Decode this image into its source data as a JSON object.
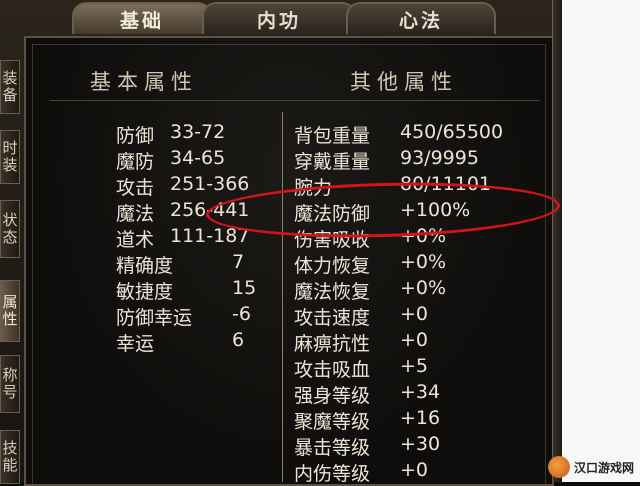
{
  "tabs": [
    {
      "label": "基础",
      "active": true
    },
    {
      "label": "内功",
      "active": false
    },
    {
      "label": "心法",
      "active": false
    }
  ],
  "side_tabs": [
    {
      "label": "装备",
      "active": false
    },
    {
      "label": "时装",
      "active": false
    },
    {
      "label": "状态",
      "active": false
    },
    {
      "label": "属性",
      "active": true
    },
    {
      "label": "称号",
      "active": false
    },
    {
      "label": "技能",
      "active": false
    }
  ],
  "left_section_title": "基本属性",
  "right_section_title": "其他属性",
  "basic_stats": [
    {
      "name": "防御",
      "value": "33-72"
    },
    {
      "name": "魔防",
      "value": "34-65"
    },
    {
      "name": "攻击",
      "value": "251-366"
    },
    {
      "name": "魔法",
      "value": "256-441"
    },
    {
      "name": "道术",
      "value": "111-187"
    },
    {
      "name": "精确度",
      "value": "7"
    },
    {
      "name": "敏捷度",
      "value": "15"
    },
    {
      "name": "防御幸运",
      "value": "-6"
    },
    {
      "name": "幸运",
      "value": "6"
    }
  ],
  "other_stats": [
    {
      "name": "背包重量",
      "value": "450/65500"
    },
    {
      "name": "穿戴重量",
      "value": "93/9995"
    },
    {
      "name": "腕力",
      "value": "80/11101"
    },
    {
      "name": "魔法防御",
      "value": "+100%"
    },
    {
      "name": "伤害吸收",
      "value": "+0%"
    },
    {
      "name": "体力恢复",
      "value": "+0%"
    },
    {
      "name": "魔法恢复",
      "value": "+0%"
    },
    {
      "name": "攻击速度",
      "value": "+0"
    },
    {
      "name": "麻痹抗性",
      "value": "+0"
    },
    {
      "name": "攻击吸血",
      "value": "+5"
    },
    {
      "name": "强身等级",
      "value": "+34"
    },
    {
      "name": "聚魔等级",
      "value": "+16"
    },
    {
      "name": "暴击等级",
      "value": "+30"
    },
    {
      "name": "内伤等级",
      "value": "+0"
    }
  ],
  "highlight_color": "#d3141a",
  "watermark": {
    "text": "汉口游戏网"
  }
}
